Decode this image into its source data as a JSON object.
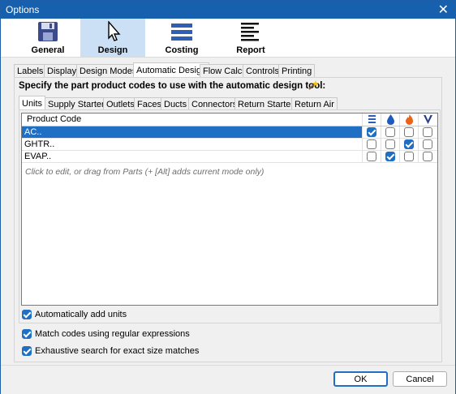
{
  "window": {
    "title": "Options"
  },
  "ribbon": {
    "buttons": [
      {
        "label": "General",
        "icon": "floppy-disk-icon"
      },
      {
        "label": "Design",
        "icon": "cursor-arrow-icon",
        "active": true
      },
      {
        "label": "Costing",
        "icon": "stacked-bars-icon"
      },
      {
        "label": "Report",
        "icon": "text-lines-icon"
      }
    ]
  },
  "tabs": [
    "Labels",
    "Display",
    "Design Modes",
    "Automatic Design",
    "Flow Calcs",
    "Controls",
    "Printing"
  ],
  "active_tab": "Automatic Design",
  "section": {
    "heading": "Specify the part product codes to use with the automatic design tool:"
  },
  "subtabs": [
    "Units",
    "Supply Starters",
    "Outlets",
    "Faces",
    "Ducts",
    "Connectors",
    "Return Starters",
    "Return Air"
  ],
  "active_subtab": "Units",
  "grid": {
    "header": "Product Code",
    "column_icons": [
      "bars-icon",
      "water-drop-icon",
      "flame-icon",
      "v-logo-icon"
    ],
    "rows": [
      {
        "code": "AC..",
        "checks": [
          true,
          false,
          false,
          false
        ],
        "selected": true
      },
      {
        "code": "GHTR..",
        "checks": [
          false,
          false,
          true,
          false
        ]
      },
      {
        "code": "EVAP..",
        "checks": [
          false,
          true,
          false,
          false
        ]
      }
    ],
    "hint": "Click to edit, or drag from Parts (+ [Alt] adds current mode only)"
  },
  "options": {
    "auto_add_units": {
      "label": "Automatically add units",
      "checked": true
    },
    "match_regex": {
      "label": "Match codes using regular expressions",
      "checked": true
    },
    "exhaustive": {
      "label": "Exhaustive search for exact size matches",
      "checked": true
    }
  },
  "buttons": {
    "ok": "OK",
    "cancel": "Cancel"
  },
  "colors": {
    "accent": "#1f6fc5",
    "titlebar": "#1760ad",
    "ribbon_active": "#cce0f5"
  }
}
